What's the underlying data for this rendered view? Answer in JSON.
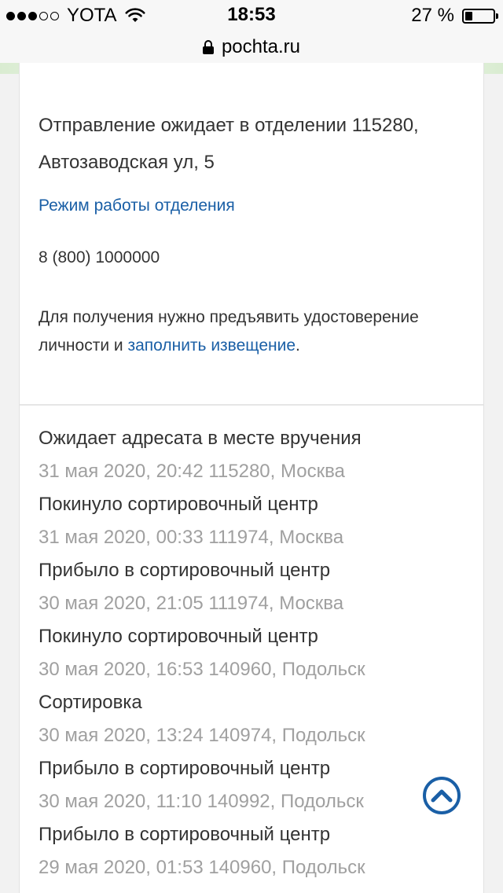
{
  "status_bar": {
    "carrier": "YOTA",
    "time": "18:53",
    "battery_percent": "27 %",
    "battery_level": 0.27,
    "signal_bars_filled": 3,
    "signal_bars_total": 5
  },
  "browser": {
    "url": "pochta.ru"
  },
  "office": {
    "title": "Отправление ожидает в отделении 115280, Автозаводская ул, 5",
    "hours_link": "Режим работы отделения",
    "phone": "8 (800) 1000000",
    "requirement_prefix": "Для получения нужно предъявить удостоверение личности и ",
    "requirement_link": "заполнить извещение",
    "requirement_suffix": "."
  },
  "history": [
    {
      "status": "Ожидает адресата в месте вручения",
      "meta": "31 мая 2020, 20:42 115280, Москва"
    },
    {
      "status": "Покинуло сортировочный центр",
      "meta": "31 мая 2020, 00:33 111974, Москва"
    },
    {
      "status": "Прибыло в сортировочный центр",
      "meta": "30 мая 2020, 21:05 111974, Москва"
    },
    {
      "status": "Покинуло сортировочный центр",
      "meta": "30 мая 2020, 16:53 140960, Подольск"
    },
    {
      "status": "Сортировка",
      "meta": "30 мая 2020, 13:24 140974, Подольск"
    },
    {
      "status": "Прибыло в сортировочный центр",
      "meta": "30 мая 2020, 11:10 140992, Подольск"
    },
    {
      "status": "Прибыло в сортировочный центр",
      "meta": "29 мая 2020, 01:53 140960, Подольск"
    }
  ],
  "colors": {
    "link": "#1a5fa6",
    "text": "#333333",
    "meta": "#a0a0a0"
  },
  "icons": {
    "scroll_top": "chevron-up-icon",
    "lock": "lock-icon",
    "wifi": "wifi-icon"
  }
}
